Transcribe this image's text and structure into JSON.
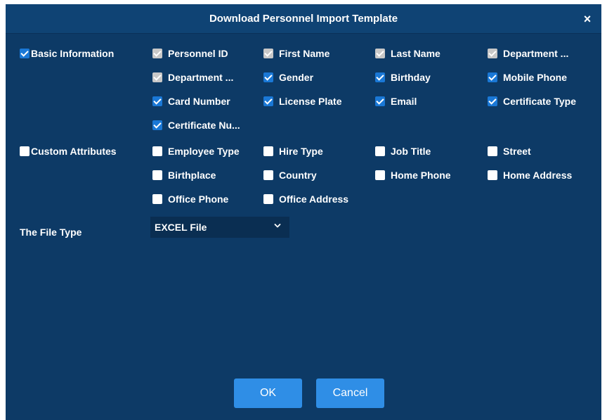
{
  "dialog": {
    "title": "Download Personnel Import Template",
    "close_symbol": "×"
  },
  "basic": {
    "label": "Basic Information",
    "fields": [
      {
        "label": "Personnel ID",
        "state": "disabled"
      },
      {
        "label": "First Name",
        "state": "disabled"
      },
      {
        "label": "Last Name",
        "state": "disabled"
      },
      {
        "label": "Department ...",
        "state": "disabled"
      },
      {
        "label": "Department ...",
        "state": "disabled"
      },
      {
        "label": "Gender",
        "state": "checked"
      },
      {
        "label": "Birthday",
        "state": "checked"
      },
      {
        "label": "Mobile Phone",
        "state": "checked"
      },
      {
        "label": "Card Number",
        "state": "checked"
      },
      {
        "label": "License Plate",
        "state": "checked"
      },
      {
        "label": "Email",
        "state": "checked"
      },
      {
        "label": "Certificate Type",
        "state": "checked"
      },
      {
        "label": "Certificate Nu...",
        "state": "checked"
      }
    ]
  },
  "custom": {
    "label": "Custom Attributes",
    "fields": [
      {
        "label": "Employee Type",
        "state": "unchecked"
      },
      {
        "label": "Hire Type",
        "state": "unchecked"
      },
      {
        "label": "Job Title",
        "state": "unchecked"
      },
      {
        "label": "Street",
        "state": "unchecked"
      },
      {
        "label": "Birthplace",
        "state": "unchecked"
      },
      {
        "label": "Country",
        "state": "unchecked"
      },
      {
        "label": "Home Phone",
        "state": "unchecked"
      },
      {
        "label": "Home Address",
        "state": "unchecked"
      },
      {
        "label": "Office Phone",
        "state": "unchecked"
      },
      {
        "label": "Office Address",
        "state": "unchecked"
      }
    ]
  },
  "file_type": {
    "label": "The File Type",
    "selected": "EXCEL File"
  },
  "buttons": {
    "ok": "OK",
    "cancel": "Cancel"
  },
  "colors": {
    "dialog_bg": "#0d3a66",
    "title_bg": "#0f4374",
    "accent": "#2f8ee6"
  }
}
